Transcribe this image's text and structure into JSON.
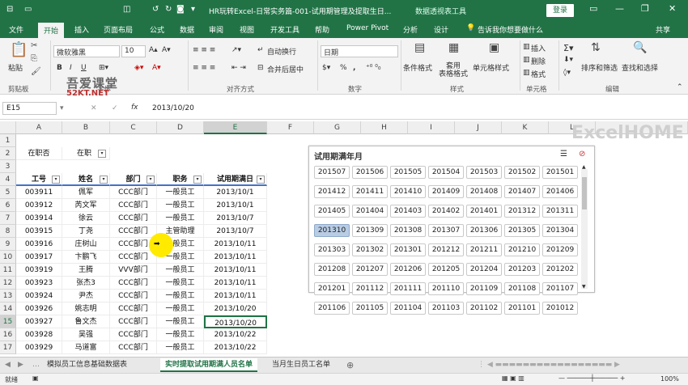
{
  "window": {
    "title": "HR玩转Excel-日常实务篇-001-试用期管理及提取生日...",
    "context_tab": "数据透视表工具",
    "login_label": "登录",
    "qat": [
      "↺",
      "↻",
      "▭",
      "◻",
      "▭"
    ],
    "win_buttons": [
      "▭",
      "—",
      "❐",
      "✕"
    ]
  },
  "tabs": [
    "文件",
    "开始",
    "插入",
    "页面布局",
    "公式",
    "数据",
    "审阅",
    "视图",
    "开发工具",
    "帮助",
    "Power Pivot",
    "分析",
    "设计"
  ],
  "tell_me": "告诉我你想要做什么",
  "share_label": "共享",
  "ribbon": {
    "paste_label": "粘贴",
    "font_name": "微软雅黑",
    "font_size": "10",
    "bold": "B",
    "italic": "I",
    "underline": "U",
    "wrap_label": "自动换行",
    "merge_label": "合并后居中",
    "number_format": "日期",
    "pct": "%",
    "comma": ",",
    "cond_format_label": "条件格式",
    "table_format_label": "套用\n表格格式",
    "cell_style_label": "单元格样式",
    "insert_label": "插入",
    "delete_label": "删除",
    "format_label": "格式",
    "sort_filter_label": "排序和筛选",
    "find_select_label": "查找和选择",
    "groups": [
      "剪贴板",
      "字体",
      "对齐方式",
      "数字",
      "样式",
      "单元格",
      "编辑"
    ]
  },
  "formula_bar": {
    "name_box": "E15",
    "fx": "fx",
    "value": "2013/10/20"
  },
  "columns": [
    "A",
    "B",
    "C",
    "D",
    "E",
    "F",
    "G",
    "H",
    "I",
    "J",
    "K",
    "L"
  ],
  "rows": [
    "1",
    "2",
    "3",
    "4",
    "5",
    "6",
    "7",
    "8",
    "9",
    "10",
    "11",
    "12",
    "13",
    "14",
    "15",
    "16",
    "17"
  ],
  "filter_row": {
    "label": "在职否",
    "value": "在职"
  },
  "table": {
    "headers": [
      "工号",
      "姓名",
      "部门",
      "职务",
      "试用期满日"
    ],
    "rows": [
      [
        "003911",
        "佩军",
        "CCC部门",
        "一般员工",
        "2013/10/1"
      ],
      [
        "003912",
        "芮文军",
        "CCC部门",
        "一般员工",
        "2013/10/1"
      ],
      [
        "003914",
        "徐云",
        "CCC部门",
        "一般员工",
        "2013/10/7"
      ],
      [
        "003915",
        "丁尧",
        "CCC部门",
        "主管助理",
        "2013/10/7"
      ],
      [
        "003916",
        "庄树山",
        "CCC部门",
        "一般员工",
        "2013/10/11"
      ],
      [
        "003917",
        "卞鹏飞",
        "CCC部门",
        "一般员工",
        "2013/10/11"
      ],
      [
        "003919",
        "王腾",
        "VVV部门",
        "一般员工",
        "2013/10/11"
      ],
      [
        "003923",
        "张杰3",
        "CCC部门",
        "一般员工",
        "2013/10/11"
      ],
      [
        "003924",
        "尹杰",
        "CCC部门",
        "一般员工",
        "2013/10/11"
      ],
      [
        "003926",
        "姚志明",
        "CCC部门",
        "一般员工",
        "2013/10/20"
      ],
      [
        "003927",
        "鲁文杰",
        "CCC部门",
        "一般员工",
        "2013/10/20"
      ],
      [
        "003928",
        "吴强",
        "CCC部门",
        "一般员工",
        "2013/10/22"
      ],
      [
        "003929",
        "马道富",
        "CCC部门",
        "一般员工",
        "2013/10/22"
      ]
    ]
  },
  "slicer": {
    "title": "试用期满年月",
    "selected": "201310",
    "items": [
      "201507",
      "201506",
      "201505",
      "201504",
      "201503",
      "201502",
      "201501",
      "201412",
      "201411",
      "201410",
      "201409",
      "201408",
      "201407",
      "201406",
      "201405",
      "201404",
      "201403",
      "201402",
      "201401",
      "201312",
      "201311",
      "201310",
      "201309",
      "201308",
      "201307",
      "201306",
      "201305",
      "201304",
      "201303",
      "201302",
      "201301",
      "201212",
      "201211",
      "201210",
      "201209",
      "201208",
      "201207",
      "201206",
      "201205",
      "201204",
      "201203",
      "201202",
      "201201",
      "201112",
      "201111",
      "201110",
      "201109",
      "201108",
      "201107",
      "201106",
      "201105",
      "201104",
      "201103",
      "201102",
      "201101",
      "201012"
    ]
  },
  "sheets": [
    "模拟员工信息基础数据表",
    "实时提取试用期满人员名单",
    "当月生日员工名单"
  ],
  "active_sheet": "实时提取试用期满人员名单",
  "status": {
    "mode": "就绪",
    "zoom": "100%"
  },
  "watermarks": {
    "left_top": "吾爱课堂",
    "left_bottom": "52KT.NET",
    "right": "ExcelHOME"
  },
  "colors": {
    "accent": "#217346",
    "slicer_selected": "#b8cce4",
    "table_header_line": "#4472c4"
  }
}
